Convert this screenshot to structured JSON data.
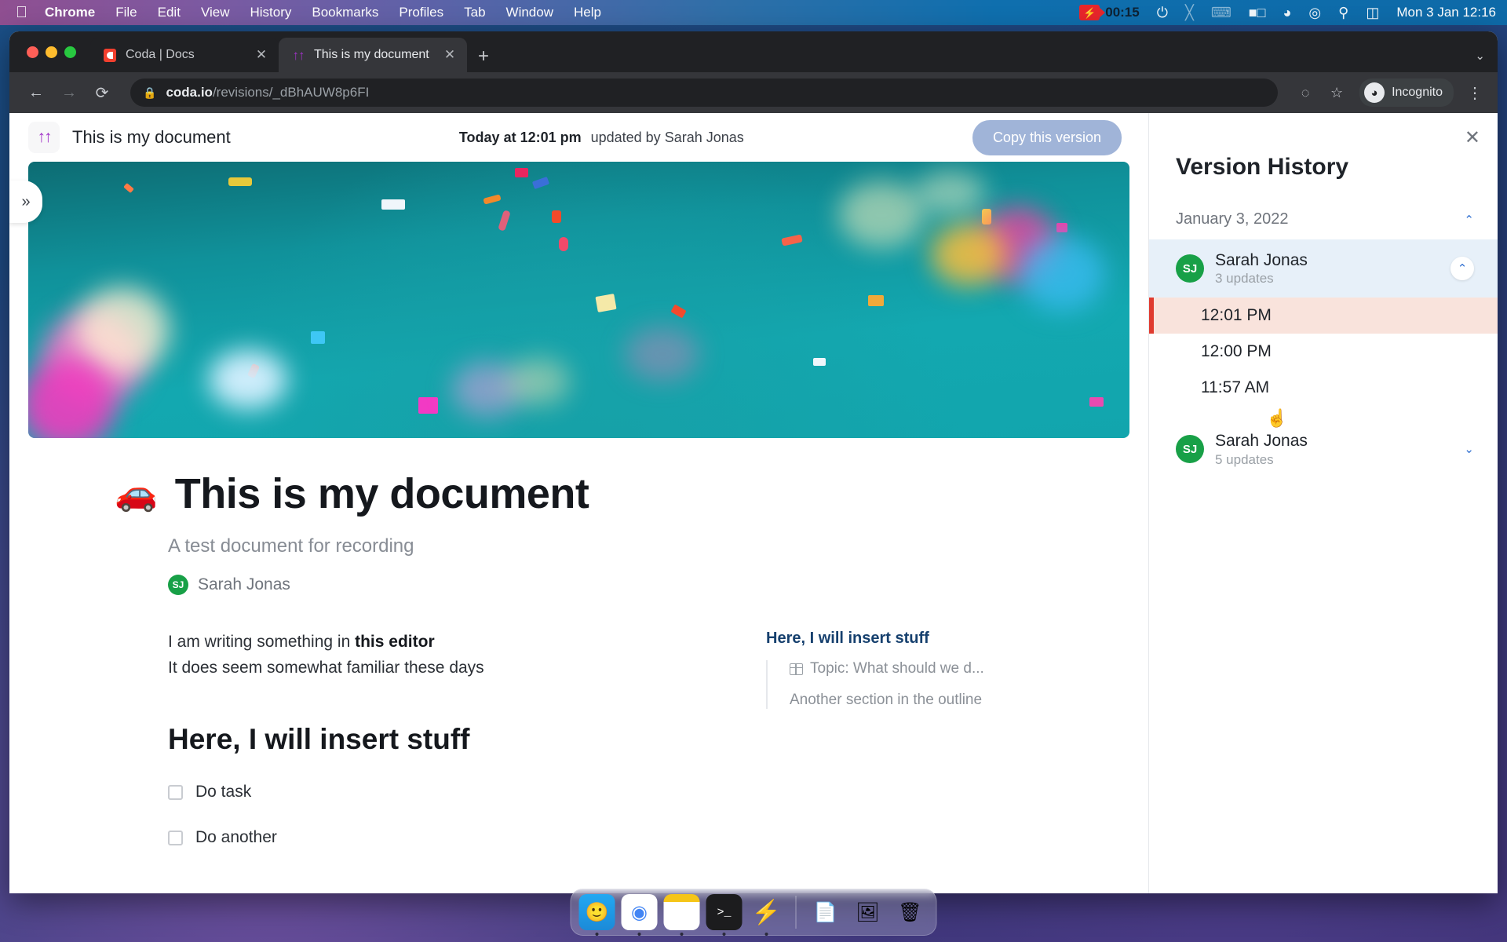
{
  "menubar": {
    "apple_icon": "apple-logo",
    "items": [
      {
        "label": "Chrome",
        "bold": true
      },
      {
        "label": "File",
        "bold": false
      },
      {
        "label": "Edit",
        "bold": false
      },
      {
        "label": "View",
        "bold": false
      },
      {
        "label": "History",
        "bold": false
      },
      {
        "label": "Bookmarks",
        "bold": false
      },
      {
        "label": "Profiles",
        "bold": false
      },
      {
        "label": "Tab",
        "bold": false
      },
      {
        "label": "Window",
        "bold": false
      },
      {
        "label": "Help",
        "bold": false
      }
    ],
    "recording_time": "00:15",
    "status_icons": [
      "bolt-icon",
      "bluetooth-off-icon",
      "keyboard-icon",
      "battery-icon",
      "wifi-icon",
      "account-icon",
      "search-icon",
      "control-center-icon"
    ],
    "clock": "Mon 3 Jan  12:16"
  },
  "browser": {
    "tabs": [
      {
        "title": "Coda | Docs",
        "active": false,
        "favicon": "coda-icon"
      },
      {
        "title": "This is my document",
        "active": true,
        "favicon": "coda-doc-icon"
      }
    ],
    "new_tab_label": "+",
    "tab_list_label": "⌄",
    "back_label": "←",
    "forward_label": "→",
    "reload_label": "⟳",
    "lock_label": "🔒",
    "url_domain": "coda.io",
    "url_path": "/revisions/_dBhAUW8p6FI",
    "extension_label": "◌",
    "bookmark_label": "☆",
    "incognito_label": "Incognito",
    "menu_label": "⋮"
  },
  "doc_topbar": {
    "icon": "coda-doc-icon",
    "title": "This is my document",
    "updated_time": "Today at 12:01 pm",
    "updated_by": "updated by Sarah Jonas",
    "copy_button": "Copy this version"
  },
  "document": {
    "expand_label": "»",
    "emoji": "🚗",
    "title": "This is my document",
    "subtitle": "A test document for recording",
    "author_initials": "SJ",
    "author_name": "Sarah Jonas",
    "paragraph_1_pre": "I am writing something in ",
    "paragraph_1_bold": "this editor",
    "paragraph_2": "It does seem somewhat familiar these days",
    "heading_2": "Here, I will insert stuff",
    "checklist": [
      {
        "label": "Do task",
        "checked": false
      },
      {
        "label": "Do another",
        "checked": false
      }
    ],
    "outline": {
      "title": "Here, I will insert stuff",
      "items": [
        {
          "label": "Topic: What should we d...",
          "icon": "table-icon"
        },
        {
          "label": "Another section in the outline",
          "icon": null
        }
      ]
    }
  },
  "version_history": {
    "close_label": "✕",
    "heading": "Version History",
    "date_group": "January 3, 2022",
    "date_chevron": "⌃",
    "groups": [
      {
        "name": "Sarah Jonas",
        "initials": "SJ",
        "updates": "3 updates",
        "expanded": true,
        "chevron": "⌃",
        "selected": true,
        "revisions": [
          {
            "time": "12:01 PM",
            "current": true
          },
          {
            "time": "12:00 PM",
            "current": false
          },
          {
            "time": "11:57 AM",
            "current": false
          }
        ]
      },
      {
        "name": "Sarah Jonas",
        "initials": "SJ",
        "updates": "5 updates",
        "expanded": false,
        "chevron": "⌄",
        "selected": false,
        "revisions": []
      }
    ]
  },
  "dock": {
    "items": [
      {
        "name": "finder",
        "glyph": "🙂",
        "running": true
      },
      {
        "name": "chrome",
        "glyph": "◉",
        "running": true
      },
      {
        "name": "notes",
        "glyph": "",
        "running": true
      },
      {
        "name": "terminal",
        "glyph": ">_",
        "running": true
      },
      {
        "name": "lightning-app",
        "glyph": "⚡",
        "running": true
      },
      {
        "name": "document-file",
        "glyph": "📄",
        "running": false
      },
      {
        "name": "screenshot-file",
        "glyph": "🖼",
        "running": false
      },
      {
        "name": "trash",
        "glyph": "🗑",
        "running": false
      }
    ]
  },
  "colors": {
    "accent_purple": "#a233c9",
    "avatar_green": "#18a047",
    "selected_blue": "#e7f0f9",
    "current_revision_peach": "#f9e3dc",
    "current_revision_bar": "#e03b2f",
    "copy_button": "#a0b4d8",
    "banner_teal": "#13a8b0",
    "outline_heading": "#16406e"
  }
}
